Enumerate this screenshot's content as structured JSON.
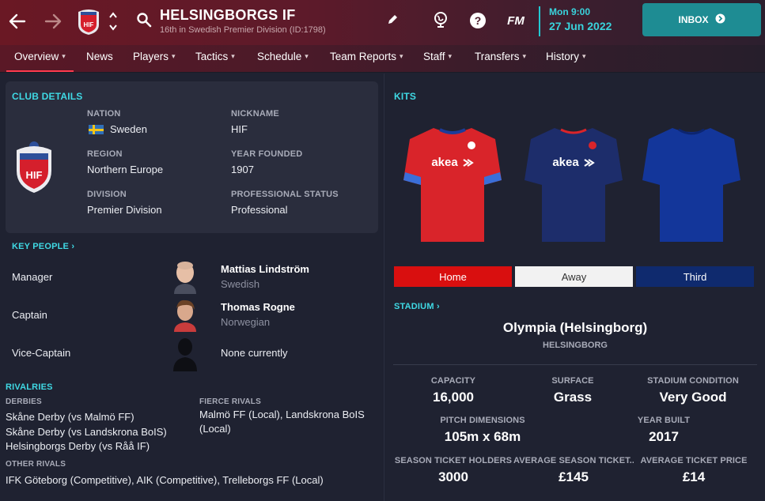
{
  "header": {
    "club_name": "HELSINGBORGS IF",
    "subtitle": "16th in Swedish Premier Division (ID:1798)",
    "fm_label": "FM",
    "date_day": "Mon 9:00",
    "date_date": "27 Jun 2022",
    "inbox_label": "INBOX",
    "crest_text": "HIF"
  },
  "nav": {
    "items": [
      "Overview",
      "News",
      "Players",
      "Tactics",
      "Schedule",
      "Team Reports",
      "Staff",
      "Transfers",
      "History"
    ]
  },
  "club_details": {
    "section_title": "CLUB DETAILS",
    "nation_label": "NATION",
    "nation_value": "Sweden",
    "nickname_label": "NICKNAME",
    "nickname_value": "HIF",
    "region_label": "REGION",
    "region_value": "Northern Europe",
    "year_founded_label": "YEAR FOUNDED",
    "year_founded_value": "1907",
    "division_label": "DIVISION",
    "division_value": "Premier Division",
    "status_label": "PROFESSIONAL STATUS",
    "status_value": "Professional"
  },
  "key_people": {
    "section_title": "KEY PEOPLE",
    "rows": [
      {
        "role": "Manager",
        "name": "Mattias Lindström",
        "nationality": "Swedish"
      },
      {
        "role": "Captain",
        "name": "Thomas Rogne",
        "nationality": "Norwegian"
      },
      {
        "role": "Vice-Captain",
        "name": "None currently",
        "nationality": ""
      }
    ]
  },
  "rivalries": {
    "section_title": "RIVALRIES",
    "derbies_label": "DERBIES",
    "derbies": [
      "Skåne Derby (vs Malmö FF)",
      "Skåne Derby (vs Landskrona BoIS)",
      "Helsingborgs Derby (vs Råå IF)"
    ],
    "fierce_label": "FIERCE RIVALS",
    "fierce_line1": "Malmö FF (Local), Landskrona BoIS",
    "fierce_line2": "(Local)",
    "other_label": "OTHER RIVALS",
    "other_value": "IFK Göteborg (Competitive), AIK (Competitive), Trelleborgs FF (Local)"
  },
  "kits": {
    "section_title": "KITS",
    "sponsor": "akea",
    "tabs": [
      {
        "label": "Home",
        "bg": "#d90f0f",
        "fg": "#ffffff"
      },
      {
        "label": "Away",
        "bg": "#f2f2f2",
        "fg": "#333333"
      },
      {
        "label": "Third",
        "bg": "#0f2a6e",
        "fg": "#ffffff"
      }
    ]
  },
  "stadium": {
    "section_title": "STADIUM",
    "name": "Olympia (Helsingborg)",
    "city": "HELSINGBORG",
    "capacity_label": "CAPACITY",
    "capacity_value": "16,000",
    "surface_label": "SURFACE",
    "surface_value": "Grass",
    "condition_label": "STADIUM CONDITION",
    "condition_value": "Very Good",
    "pitch_label": "PITCH DIMENSIONS",
    "pitch_value": "105m x 68m",
    "year_built_label": "YEAR BUILT",
    "year_built_value": "2017",
    "season_holders_label": "SEASON TICKET HOLDERS",
    "season_holders_value": "3000",
    "avg_season_label": "AVERAGE SEASON TICKET...",
    "avg_season_value": "£145",
    "avg_ticket_label": "AVERAGE TICKET PRICE",
    "avg_ticket_value": "£14"
  },
  "colors": {
    "accent_cyan": "#3fd9e4",
    "inbox": "#1e8c93",
    "nav_underline": "#ff3b4e"
  }
}
